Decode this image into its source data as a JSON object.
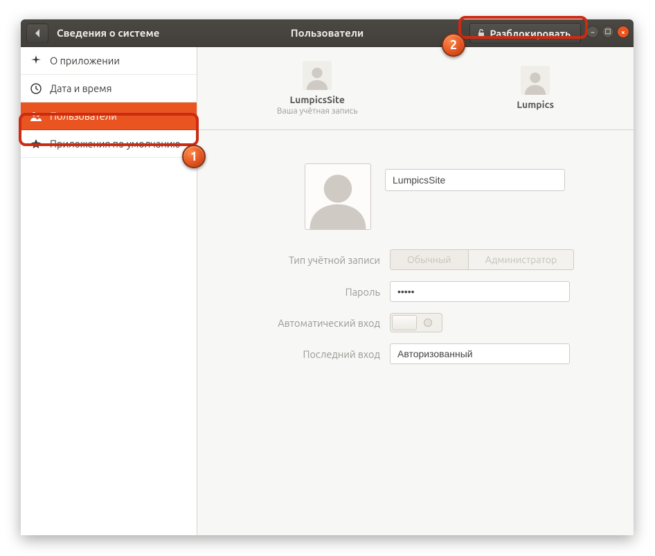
{
  "header": {
    "left_title": "Сведения о системе",
    "center_title": "Пользователи",
    "unlock_label": "Разблокировать"
  },
  "sidebar": {
    "items": [
      {
        "id": "about",
        "label": "О приложении"
      },
      {
        "id": "datetime",
        "label": "Дата и время"
      },
      {
        "id": "users",
        "label": "Пользователи"
      },
      {
        "id": "defaults",
        "label": "Приложения по умолчанию"
      }
    ],
    "selected": "users"
  },
  "users_strip": [
    {
      "name": "LumpicsSite",
      "sub": "Ваша учётная запись"
    },
    {
      "name": "Lumpics",
      "sub": ""
    }
  ],
  "detail": {
    "name_value": "LumpicsSite",
    "labels": {
      "account_type": "Тип учётной записи",
      "password": "Пароль",
      "autologin": "Автоматический вход",
      "last_login": "Последний вход"
    },
    "account_type_options": {
      "standard": "Обычный",
      "admin": "Администратор"
    },
    "account_type_value": "standard",
    "password_masked": "•••••",
    "autologin_on": false,
    "last_login_value": "Авторизованный"
  },
  "annotations": {
    "badge1": "1",
    "badge2": "2"
  }
}
